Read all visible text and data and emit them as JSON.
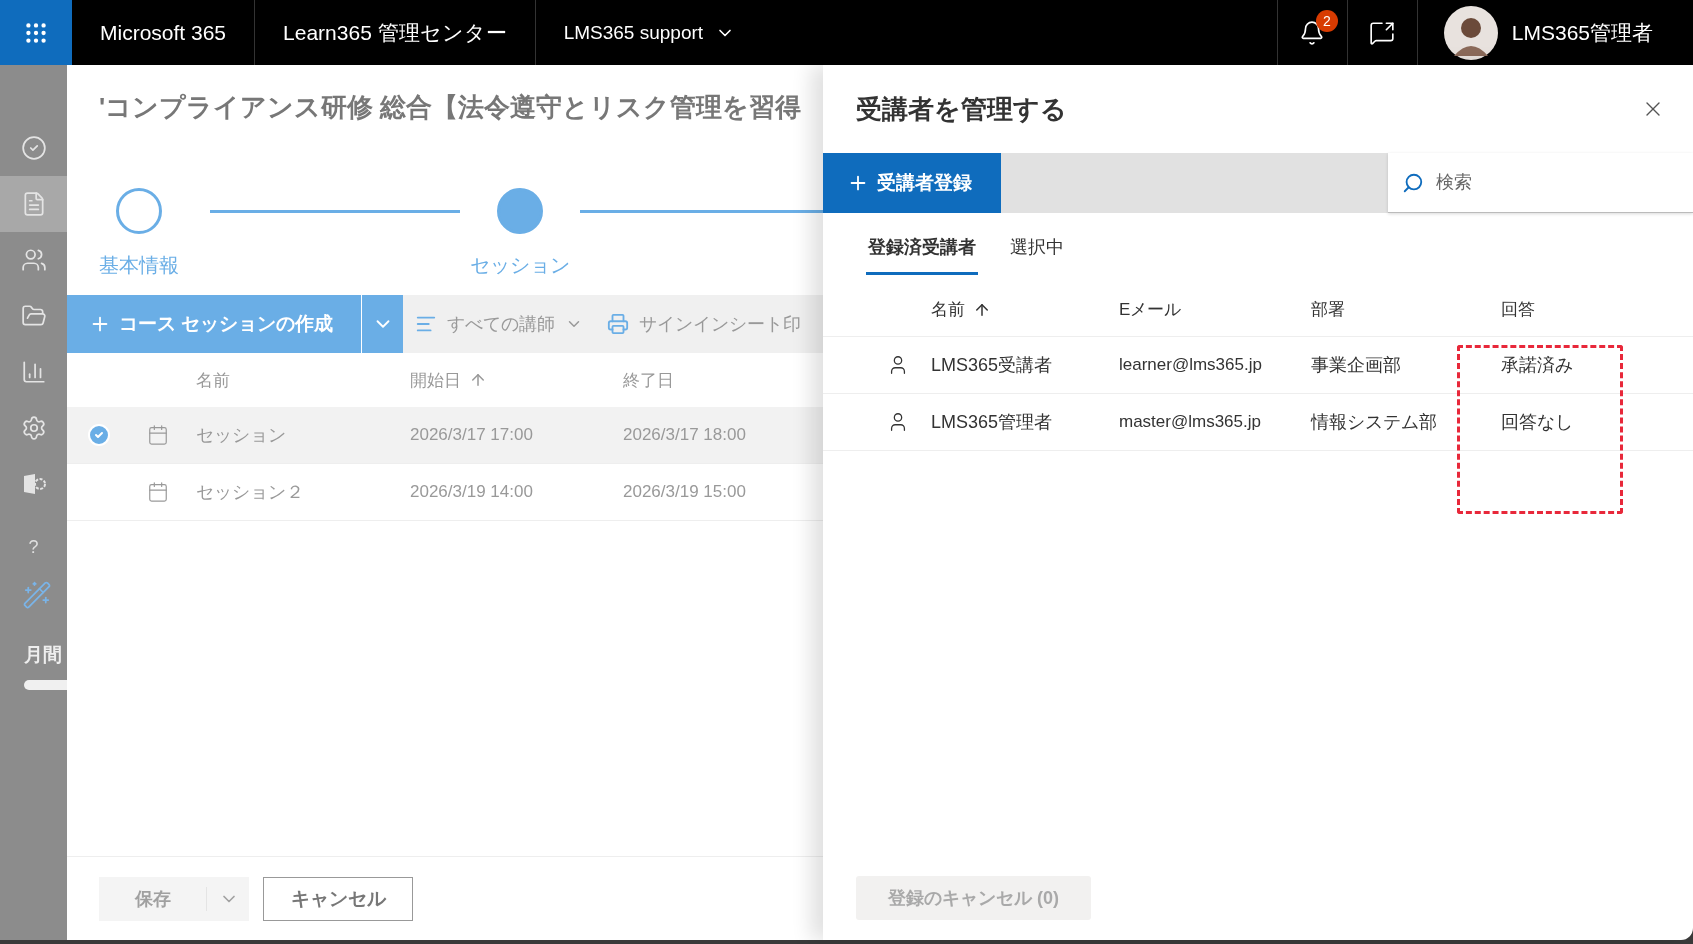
{
  "top_bar": {
    "app_name": "Microsoft 365",
    "section": "Learn365 管理センター",
    "tenant": "LMS365 support",
    "notification_count": "2",
    "user_name": "LMS365管理者"
  },
  "sidebar": {
    "items": [
      {
        "kind": "check",
        "selected": false
      },
      {
        "kind": "document",
        "selected": true
      },
      {
        "kind": "people",
        "selected": false
      },
      {
        "kind": "folder",
        "selected": false
      },
      {
        "kind": "chart",
        "selected": false
      },
      {
        "kind": "settings",
        "selected": false
      },
      {
        "kind": "app",
        "selected": false
      }
    ],
    "help": "?",
    "usage_label": "月間"
  },
  "course_dialog": {
    "title": "'コンプライアンス研修 総合【法令遵守とリスク管理を習得",
    "steps": [
      {
        "label": "基本情報",
        "selected": false
      },
      {
        "label": "セッション",
        "selected": true
      }
    ],
    "toolbar": {
      "create_button": "コース セッションの作成",
      "filter": "すべての講師",
      "print": "サインインシート印"
    },
    "columns": [
      {
        "label": "名前",
        "sorted": false
      },
      {
        "label": "開始日",
        "sorted": true
      },
      {
        "label": "終了日",
        "sorted": false
      }
    ],
    "rows": [
      {
        "name": "セッション",
        "start": "2026/3/17 17:00",
        "end": "2026/3/17 18:00",
        "selected": true
      },
      {
        "name": "セッション２",
        "start": "2026/3/19 14:00",
        "end": "2026/3/19 15:00",
        "selected": false
      }
    ],
    "footer": {
      "save": "保存",
      "save_disabled": true,
      "cancel": "キャンセル"
    }
  },
  "attendee_panel": {
    "title": "受講者を管理する",
    "add_button": "受講者登録",
    "search_placeholder": "検索",
    "tabs": [
      {
        "label": "登録済受講者",
        "selected": true
      },
      {
        "label": "選択中",
        "selected": false
      }
    ],
    "columns": [
      {
        "label": "名前",
        "sorted": true
      },
      {
        "label": "Eメール",
        "sorted": false
      },
      {
        "label": "部署",
        "sorted": false
      },
      {
        "label": "回答",
        "sorted": false
      }
    ],
    "rows": [
      {
        "name": "LMS365受講者",
        "email": "learner@lms365.jp",
        "department": "事業企画部",
        "response": "承諾済み"
      },
      {
        "name": "LMS365管理者",
        "email": "master@lms365.jp",
        "department": "情報システム部",
        "response": "回答なし"
      }
    ],
    "cancel_button": "登録のキャンセル (0)",
    "cancel_disabled": true
  }
}
